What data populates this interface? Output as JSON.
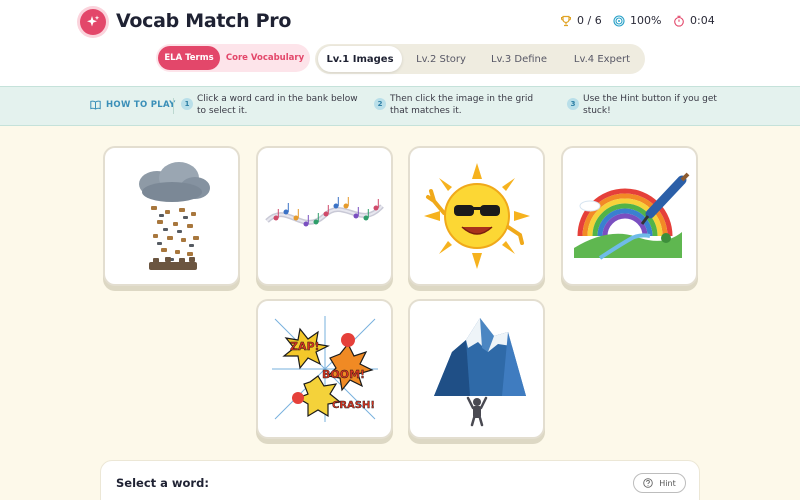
{
  "app": {
    "title": "Vocab Match Pro"
  },
  "stats": {
    "score": "0 / 6",
    "accuracy": "100%",
    "timer": "0:04"
  },
  "icons": {
    "logo": "sparkle-icon",
    "score": "trophy-icon",
    "accuracy": "target-icon",
    "timer": "stopwatch-icon",
    "howto": "book-icon",
    "hint": "help-circle-icon"
  },
  "colors": {
    "accent": "#e3476a",
    "howto_accent": "#3a8fb8",
    "background": "#fdf9ea"
  },
  "categories": {
    "items": [
      "ELA Terms",
      "Core Vocabulary"
    ],
    "active": "ELA Terms"
  },
  "levels": {
    "items": [
      "Lv.1 Images",
      "Lv.2 Story",
      "Lv.3 Define",
      "Lv.4 Expert"
    ],
    "active": "Lv.1 Images"
  },
  "howto": {
    "label": "HOW TO PLAY",
    "steps": [
      {
        "num": "1",
        "text": "Click a word card in the bank below to select it."
      },
      {
        "num": "2",
        "text": "Then click the image in the grid that matches it."
      },
      {
        "num": "3",
        "text": "Use the Hint button if you get stuck!"
      }
    ]
  },
  "grid": {
    "images": [
      "raining-cats-and-dogs",
      "music-notes-wave",
      "smiling-sun-with-sunglasses",
      "painted-rainbow-landscape",
      "zap-boom-crash-explosion",
      "mountain-carried-by-person"
    ]
  },
  "bank": {
    "title": "Select a word:",
    "hint_label": "Hint"
  }
}
